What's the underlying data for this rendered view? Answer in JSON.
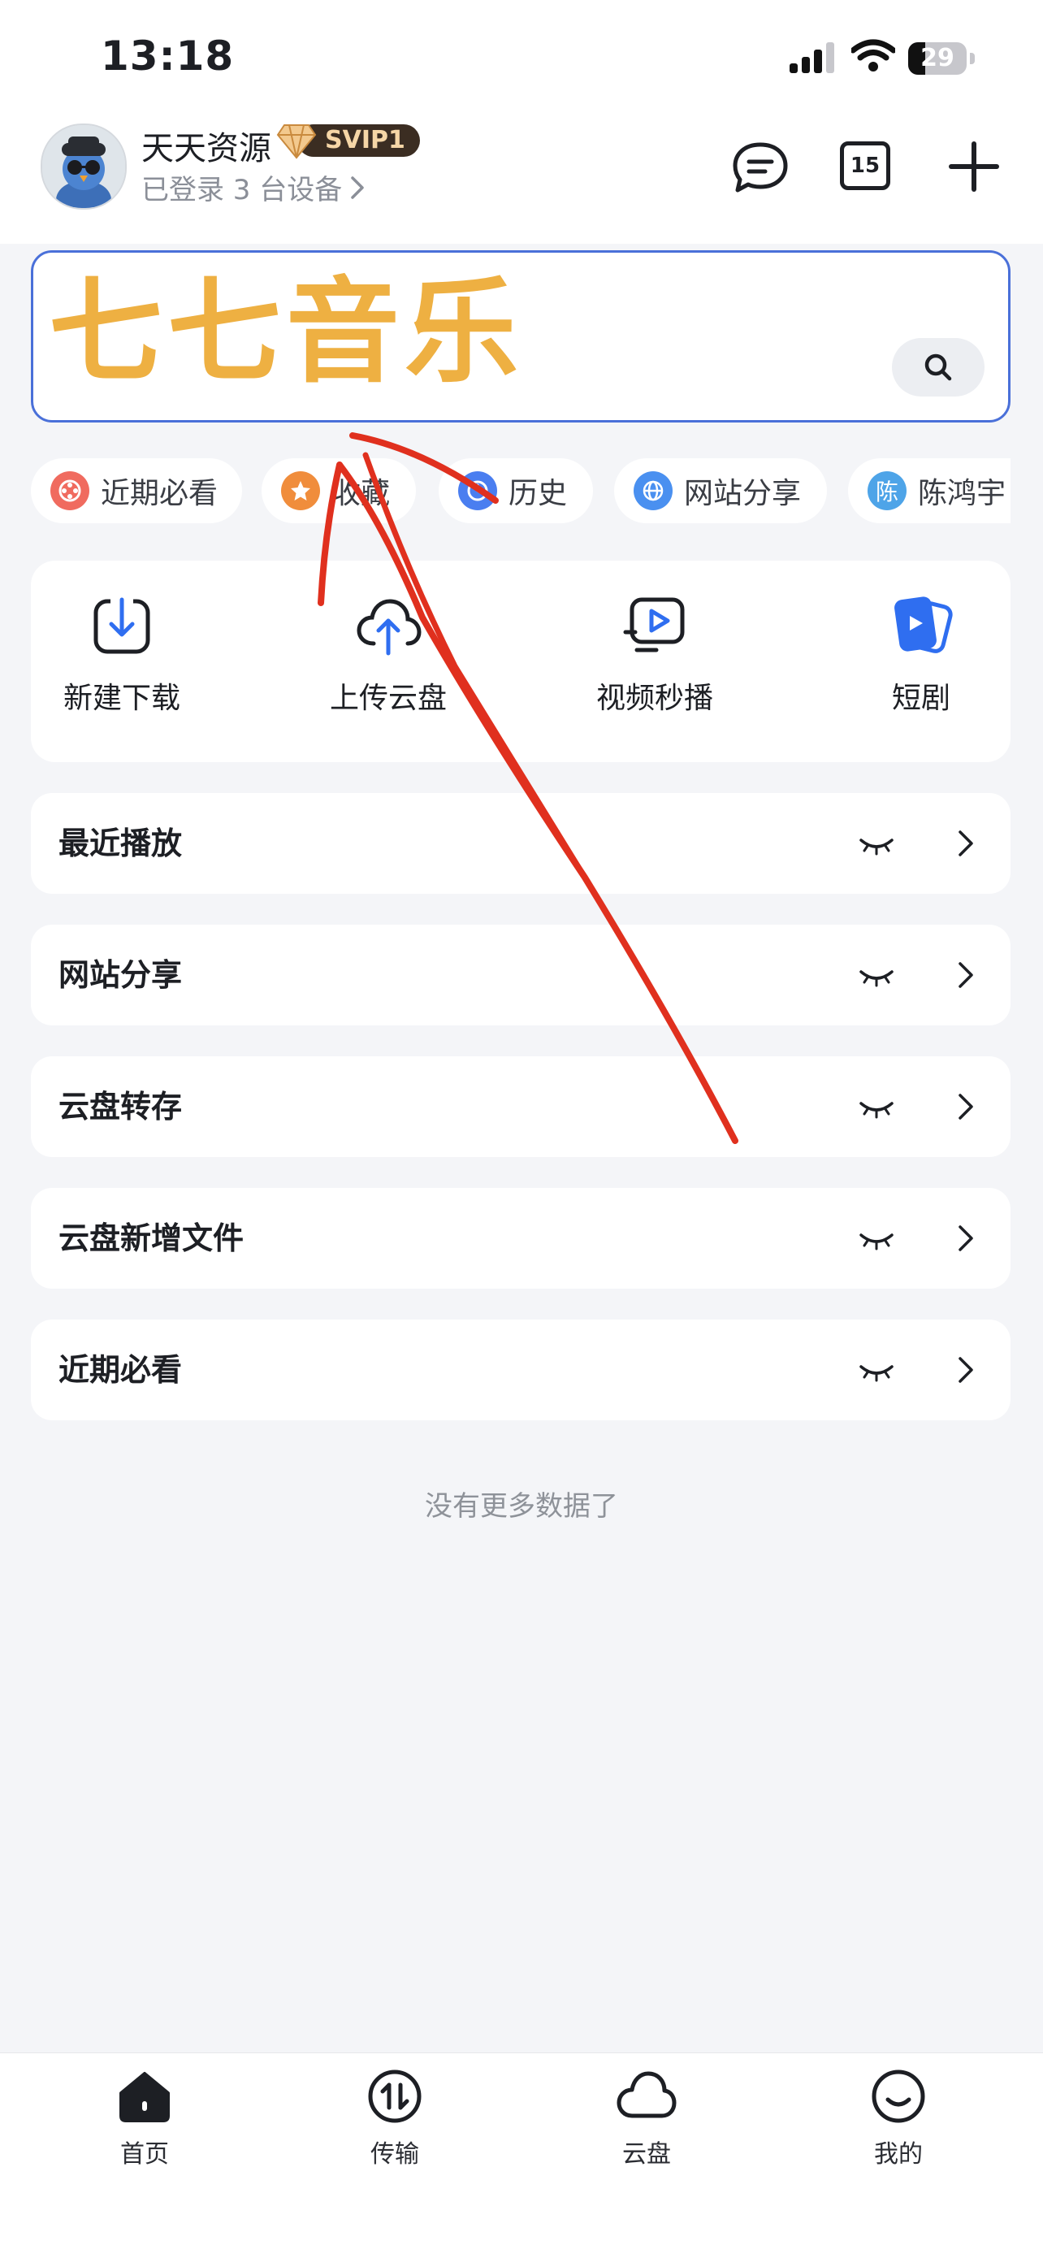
{
  "status_bar": {
    "time": "13:18",
    "battery": "29",
    "battery_level": 0.29
  },
  "header": {
    "user_name": "天天资源",
    "vip_badge": "SVIP1",
    "device_status": "已登录 3 台设备",
    "calendar_day": "15",
    "icons": [
      "message-icon",
      "calendar-icon",
      "plus-icon"
    ]
  },
  "search": {
    "value": "七七音乐",
    "button_icon": "search-icon"
  },
  "chips": [
    {
      "label": "近期必看",
      "icon": "film-reel-icon",
      "color": "#f06b5f"
    },
    {
      "label": "收藏",
      "icon": "star-icon",
      "color": "#f08d3c"
    },
    {
      "label": "历史",
      "icon": "clock-icon",
      "color": "#4a7ef0"
    },
    {
      "label": "网站分享",
      "icon": "globe-icon",
      "color": "#4a90f0"
    },
    {
      "label": "陈鸿宇",
      "icon_text": "陈",
      "color": "#4ea4e8"
    }
  ],
  "actions": [
    {
      "label": "新建下载",
      "icon": "download-icon"
    },
    {
      "label": "上传云盘",
      "icon": "cloud-upload-icon"
    },
    {
      "label": "视频秒播",
      "icon": "video-play-icon"
    },
    {
      "label": "短剧",
      "icon": "short-drama-icon"
    }
  ],
  "rows": [
    {
      "label": "最近播放"
    },
    {
      "label": "网站分享"
    },
    {
      "label": "云盘转存"
    },
    {
      "label": "云盘新增文件"
    },
    {
      "label": "近期必看"
    }
  ],
  "no_more_text": "没有更多数据了",
  "tabs": [
    {
      "label": "首页",
      "icon": "home-icon"
    },
    {
      "label": "传输",
      "icon": "transfer-icon"
    },
    {
      "label": "云盘",
      "icon": "cloud-icon"
    },
    {
      "label": "我的",
      "icon": "profile-icon"
    }
  ],
  "colors": {
    "accent": "#4a70d9",
    "search_text": "#eeb042",
    "annotation": "#e0301e",
    "background": "#f4f5f8"
  }
}
